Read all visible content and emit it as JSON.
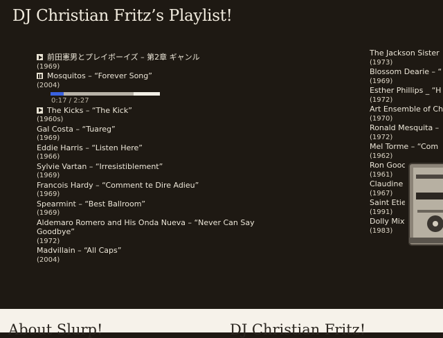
{
  "page": {
    "title": "DJ Christian Fritz’s Playlist!"
  },
  "player": {
    "time": "0:17 / 2:27",
    "played_fraction": 0.12,
    "loaded_fraction": 0.76
  },
  "playlist_left": [
    {
      "title": "前田憲男とプレイボーイズ – 第2章 ギャンル",
      "year": "(1969)",
      "button": "play"
    },
    {
      "title": "Mosquitos – “Forever Song”",
      "year": "(2004)",
      "button": "pause",
      "active": true
    },
    {
      "title": "The Kicks – “The Kick”",
      "year": "(1960s)",
      "button": "play"
    },
    {
      "title": "Gal Costa – “Tuareg”",
      "year": "(1969)"
    },
    {
      "title": "Eddie Harris – “Listen Here”",
      "year": "(1966)"
    },
    {
      "title": "Sylvie Vartan – “Irresistiblement”",
      "year": "(1969)"
    },
    {
      "title": "Francois Hardy – “Comment te Dire Adieu”",
      "year": "(1969)"
    },
    {
      "title": "Spearmint – “Best Ballroom”",
      "year": "(1969)"
    },
    {
      "title": "Aldemaro Romero and His Onda Nueva – “Never Can Say Goodbye”",
      "year": "(1972)"
    },
    {
      "title": "Madvillain – “All Caps”",
      "year": "(2004)"
    }
  ],
  "playlist_right": [
    {
      "title": "The Jackson Sister",
      "year": "(1973)"
    },
    {
      "title": "Blossom Dearie – “",
      "year": "(1969)"
    },
    {
      "title": "Esther Phillips _ “H",
      "year": "(1972)"
    },
    {
      "title": "Art Ensemble of Ch",
      "year": "(1970)"
    },
    {
      "title": "Ronald Mesquita –",
      "year": "(1972)"
    },
    {
      "title": "Mel Torme – “Com",
      "year": "(1962)"
    },
    {
      "title": "Ron Goodwin and",
      "year": "(1961)"
    },
    {
      "title": "Claudine Longet –",
      "year": "(1967)"
    },
    {
      "title": "Saint Etienne – “No",
      "year": "(1991)"
    },
    {
      "title": "Dolly Mixture – “My",
      "year": "(1983)"
    }
  ],
  "footer": {
    "about_heading": "About Slurp!",
    "dj_heading": "DJ Christian Fritz!"
  }
}
